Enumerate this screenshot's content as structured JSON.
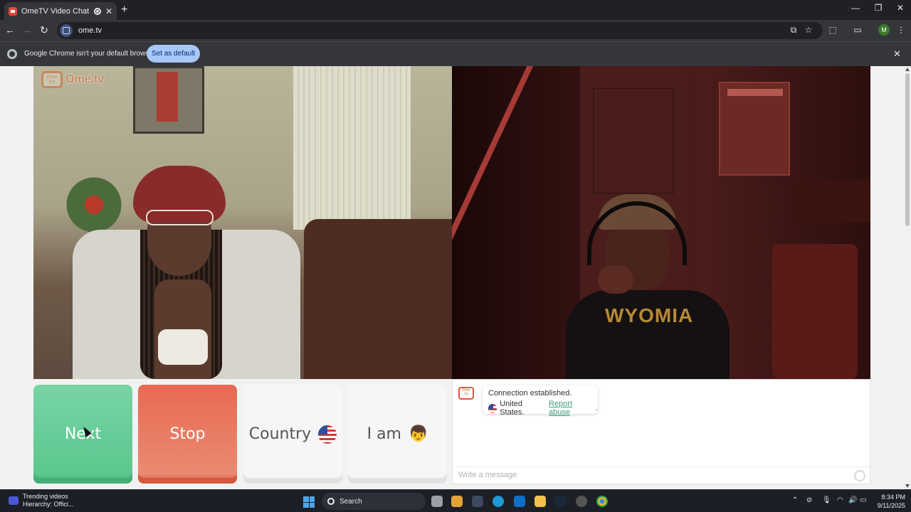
{
  "browser": {
    "tab_title": "OmeTV Video Chat — Ome",
    "tab_close": "✕",
    "new_tab": "+",
    "url": "ome.tv",
    "window_controls": {
      "minimize": "—",
      "restore": "❐",
      "close": "✕"
    },
    "avatar_letter": "M"
  },
  "infobar": {
    "message": "Google Chrome isn't your default browser",
    "button": "Set as default",
    "close": "✕"
  },
  "video": {
    "logo_text": "Ome.tv",
    "logo_badge": "Ome TV",
    "shirt_text": "WYOMIA"
  },
  "controls": {
    "next": "Next",
    "stop": "Stop",
    "country": "Country",
    "iam": "I am",
    "iam_emoji": "👦"
  },
  "chat": {
    "status": "Connection established.",
    "country": "United States.",
    "report": "Report abuse",
    "report_suffix": ".",
    "placeholder": "Write a message"
  },
  "taskbar": {
    "news_title": "Trending videos",
    "news_sub": "Hierarchy: Offici...",
    "search": "Search",
    "time": "8:34 PM",
    "date": "9/11/2025"
  },
  "colors": {
    "next": "#5cc78f",
    "stop": "#e86a52",
    "logo": "#c9875c",
    "report_link": "#3a9d78"
  }
}
